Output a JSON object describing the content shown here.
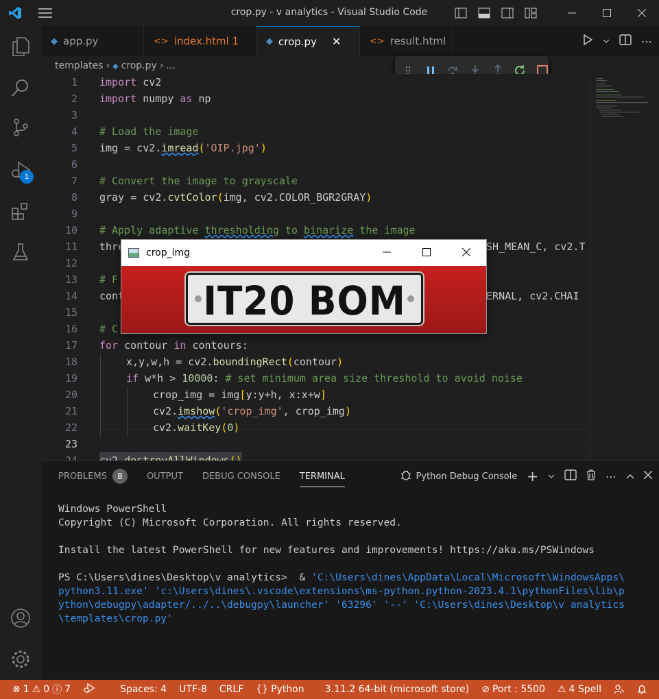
{
  "window": {
    "title": "crop.py - v analytics - Visual Studio Code"
  },
  "tabs": [
    {
      "label": "app.py",
      "icon": "python-icon",
      "modified": false,
      "active": false
    },
    {
      "label": "index.html 1",
      "icon": "html-icon",
      "modified": true,
      "active": false
    },
    {
      "label": "crop.py",
      "icon": "python-icon",
      "modified": false,
      "active": true
    },
    {
      "label": "result.html",
      "icon": "html-icon",
      "modified": false,
      "active": false
    }
  ],
  "breadcrumb": {
    "folder": "templates",
    "file": "crop.py",
    "more": "..."
  },
  "activity": {
    "debug_badge": "1"
  },
  "editor": {
    "lines": [
      {
        "n": "1"
      },
      {
        "n": "2"
      },
      {
        "n": "3"
      },
      {
        "n": "4"
      },
      {
        "n": "5"
      },
      {
        "n": "6"
      },
      {
        "n": "7"
      },
      {
        "n": "8"
      },
      {
        "n": "9"
      },
      {
        "n": "10"
      },
      {
        "n": "11"
      },
      {
        "n": "12"
      },
      {
        "n": "13"
      },
      {
        "n": "14"
      },
      {
        "n": "15"
      },
      {
        "n": "16"
      },
      {
        "n": "17"
      },
      {
        "n": "18"
      },
      {
        "n": "19"
      },
      {
        "n": "20"
      },
      {
        "n": "21"
      },
      {
        "n": "22"
      },
      {
        "n": "23"
      },
      {
        "n": "24"
      }
    ],
    "code": {
      "l1a": "import",
      "l1b": " cv2",
      "l2a": "import",
      "l2b": " numpy ",
      "l2c": "as",
      "l2d": " np",
      "l4": "# Load the image",
      "l5a": "img = cv2.",
      "l5b": "imread",
      "l5c": "(",
      "l5d": "'OIP.jpg'",
      "l5e": ")",
      "l7": "# Convert the image to grayscale",
      "l8a": "gray = cv2.",
      "l8b": "cvtColor",
      "l8c": "(",
      "l8d": "img, cv2.COLOR_BGR2GRAY",
      "l8e": ")",
      "l10a": "# Apply adaptive ",
      "l10b": "thresholding",
      "l10c": " to ",
      "l10d": "binarize",
      "l10e": " the image",
      "l11a": "thre",
      "l11b": "ESH_MEAN_C, cv2.T",
      "l13a": "# F",
      "l14a": "cont",
      "l14b": "TERNAL, cv2.CHAI",
      "l16a": "# C",
      "l17a": "for",
      "l17b": " contour ",
      "l17c": "in",
      "l17d": " contours:",
      "l18a": "x,y,w,h = cv2.",
      "l18b": "boundingRect",
      "l18c": "(",
      "l18d": "contour",
      "l18e": ")",
      "l19a": "if",
      "l19b": " w*h > ",
      "l19c": "10000",
      "l19d": ": ",
      "l19e": "# set minimum area size threshold to avoid noise",
      "l20a": "crop_img = img",
      "l20b": "[",
      "l20c": "y:y+h, x:x+w",
      "l20d": "]",
      "l21a": "cv2.",
      "l21b": "imshow",
      "l21c": "(",
      "l21d": "'crop_img'",
      "l21e": ", crop_img",
      "l21f": ")",
      "l22a": "cv2.",
      "l22b": "waitKey",
      "l22c": "(",
      "l22d": "0",
      "l22e": ")",
      "l24a": "cv2.",
      "l24b": "destroyAllWindows",
      "l24c": "()"
    }
  },
  "popup": {
    "title": "crop_img",
    "plate_text": "IT20 BOM"
  },
  "panel": {
    "tabs": {
      "problems": "PROBLEMS",
      "problems_count": "8",
      "output": "OUTPUT",
      "debug_console": "DEBUG CONSOLE",
      "terminal": "TERMINAL"
    },
    "terminal_name": "Python Debug Console",
    "terminal": {
      "t1": "Windows PowerShell",
      "t2": "Copyright (C) Microsoft Corporation. All rights reserved.",
      "t3": "Install the latest PowerShell for new features and improvements! https://aka.ms/PSWindows",
      "t4a": "PS C:\\Users\\dines\\Desktop\\v analytics>  & ",
      "t4b": "'C:\\Users\\dines\\AppData\\Local\\Microsoft\\WindowsApps\\",
      "t5": "python3.11.exe' 'c:\\Users\\dines\\.vscode\\extensions\\ms-python.python-2023.4.1\\pythonFiles\\lib\\p",
      "t6": "ython\\debugpy\\adapter/../..\\debugpy\\launcher' '63296' '--' 'C:\\Users\\dines\\Desktop\\v analytics",
      "t7": "\\templates\\crop.py'"
    }
  },
  "status": {
    "errors": "1",
    "warnings": "0",
    "info": "7",
    "spaces": "Spaces: 4",
    "encoding": "UTF-8",
    "eol": "CRLF",
    "language": "Python",
    "interpreter": "3.11.2 64-bit (microsoft store)",
    "port": "Port : 5500",
    "spell": "4 Spell"
  },
  "colors": {
    "accent": "#0078d4",
    "statusbar": "#c74e24"
  }
}
